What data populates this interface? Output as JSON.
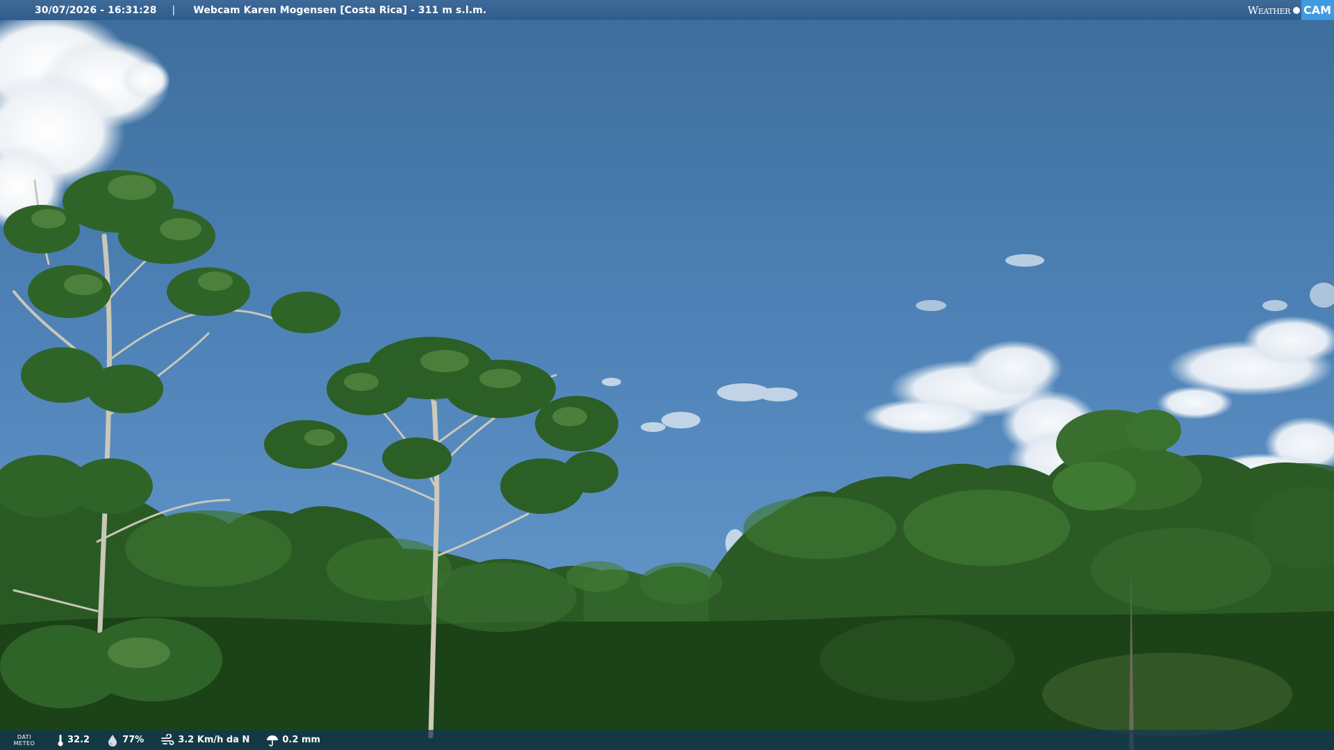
{
  "header": {
    "datetime": "30/07/2026 - 16:31:28",
    "separator": "|",
    "title": "Webcam Karen Mogensen [Costa Rica] - 311 m s.l.m."
  },
  "logo": {
    "weather_text": "Weather",
    "cam_text": "CAM"
  },
  "meteo": {
    "label_line1": "DATI",
    "label_line2": "METEO",
    "temperature": "32.2",
    "humidity": "77%",
    "wind": "3.2 Km/h da N",
    "rain": "0.2 mm"
  },
  "icons": {
    "temperature": "thermometer-icon",
    "humidity": "humidity-drop-icon",
    "wind": "wind-icon",
    "rain": "rain-umbrella-icon"
  },
  "colors": {
    "sky_top": "#3d6f9d",
    "sky_bottom": "#5f96cc",
    "foliage_dark": "#173a17",
    "foliage_light": "#4f8338",
    "logo_accent": "#3f9be1"
  }
}
